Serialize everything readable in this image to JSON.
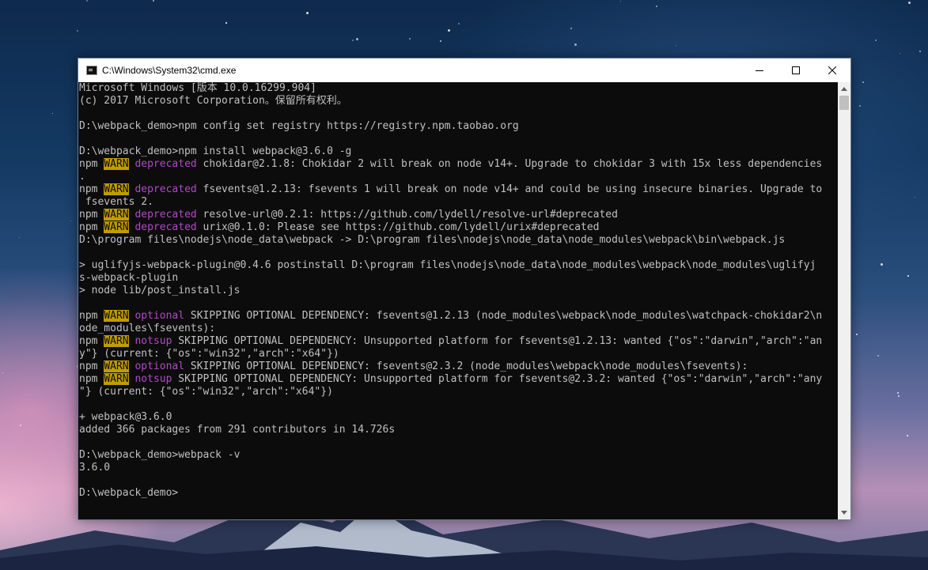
{
  "window": {
    "title": "C:\\Windows\\System32\\cmd.exe",
    "icons": {
      "app": "console-app-icon",
      "minimize": "minimize-icon",
      "maximize": "maximize-icon",
      "close": "close-icon"
    }
  },
  "colors": {
    "warn_bg": "#c19c00",
    "keyword": "#b148c6",
    "text": "#c0c0c0",
    "console_bg": "#0c0c0c"
  },
  "console": {
    "lines": [
      [
        {
          "t": "Microsoft Windows [版本 10.0.16299.904]"
        }
      ],
      [
        {
          "t": "(c) 2017 Microsoft Corporation。保留所有权利。"
        }
      ],
      [
        {
          "t": ""
        }
      ],
      [
        {
          "t": "D:\\webpack_demo>npm config set registry https://registry.npm.taobao.org"
        }
      ],
      [
        {
          "t": ""
        }
      ],
      [
        {
          "t": "D:\\webpack_demo>npm install webpack@3.6.0 -g"
        }
      ],
      [
        {
          "t": "npm "
        },
        {
          "t": "WARN",
          "c": "warn"
        },
        {
          "t": " "
        },
        {
          "t": "deprecated",
          "c": "kw"
        },
        {
          "t": " chokidar@2.1.8: Chokidar 2 will break on node v14+. Upgrade to chokidar 3 with 15x less dependencies"
        }
      ],
      [
        {
          "t": "."
        }
      ],
      [
        {
          "t": "npm "
        },
        {
          "t": "WARN",
          "c": "warn"
        },
        {
          "t": " "
        },
        {
          "t": "deprecated",
          "c": "kw"
        },
        {
          "t": " fsevents@1.2.13: fsevents 1 will break on node v14+ and could be using insecure binaries. Upgrade to"
        }
      ],
      [
        {
          "t": " fsevents 2."
        }
      ],
      [
        {
          "t": "npm "
        },
        {
          "t": "WARN",
          "c": "warn"
        },
        {
          "t": " "
        },
        {
          "t": "deprecated",
          "c": "kw"
        },
        {
          "t": " resolve-url@0.2.1: https://github.com/lydell/resolve-url#deprecated"
        }
      ],
      [
        {
          "t": "npm "
        },
        {
          "t": "WARN",
          "c": "warn"
        },
        {
          "t": " "
        },
        {
          "t": "deprecated",
          "c": "kw"
        },
        {
          "t": " urix@0.1.0: Please see https://github.com/lydell/urix#deprecated"
        }
      ],
      [
        {
          "t": "D:\\program files\\nodejs\\node_data\\webpack -> D:\\program files\\nodejs\\node_data\\node_modules\\webpack\\bin\\webpack.js"
        }
      ],
      [
        {
          "t": ""
        }
      ],
      [
        {
          "t": "> uglifyjs-webpack-plugin@0.4.6 postinstall D:\\program files\\nodejs\\node_data\\node_modules\\webpack\\node_modules\\uglifyj"
        }
      ],
      [
        {
          "t": "s-webpack-plugin"
        }
      ],
      [
        {
          "t": "> node lib/post_install.js"
        }
      ],
      [
        {
          "t": ""
        }
      ],
      [
        {
          "t": "npm "
        },
        {
          "t": "WARN",
          "c": "warn"
        },
        {
          "t": " "
        },
        {
          "t": "optional",
          "c": "kw"
        },
        {
          "t": " SKIPPING OPTIONAL DEPENDENCY: fsevents@1.2.13 (node_modules\\webpack\\node_modules\\watchpack-chokidar2\\n"
        }
      ],
      [
        {
          "t": "ode_modules\\fsevents):"
        }
      ],
      [
        {
          "t": "npm "
        },
        {
          "t": "WARN",
          "c": "warn"
        },
        {
          "t": " "
        },
        {
          "t": "notsup",
          "c": "kw"
        },
        {
          "t": " SKIPPING OPTIONAL DEPENDENCY: Unsupported platform for fsevents@1.2.13: wanted {\"os\":\"darwin\",\"arch\":\"an"
        }
      ],
      [
        {
          "t": "y\"} (current: {\"os\":\"win32\",\"arch\":\"x64\"})"
        }
      ],
      [
        {
          "t": "npm "
        },
        {
          "t": "WARN",
          "c": "warn"
        },
        {
          "t": " "
        },
        {
          "t": "optional",
          "c": "kw"
        },
        {
          "t": " SKIPPING OPTIONAL DEPENDENCY: fsevents@2.3.2 (node_modules\\webpack\\node_modules\\fsevents):"
        }
      ],
      [
        {
          "t": "npm "
        },
        {
          "t": "WARN",
          "c": "warn"
        },
        {
          "t": " "
        },
        {
          "t": "notsup",
          "c": "kw"
        },
        {
          "t": " SKIPPING OPTIONAL DEPENDENCY: Unsupported platform for fsevents@2.3.2: wanted {\"os\":\"darwin\",\"arch\":\"any"
        }
      ],
      [
        {
          "t": "\"} (current: {\"os\":\"win32\",\"arch\":\"x64\"})"
        }
      ],
      [
        {
          "t": ""
        }
      ],
      [
        {
          "t": "+ webpack@3.6.0"
        }
      ],
      [
        {
          "t": "added 366 packages from 291 contributors in 14.726s"
        }
      ],
      [
        {
          "t": ""
        }
      ],
      [
        {
          "t": "D:\\webpack_demo>webpack -v"
        }
      ],
      [
        {
          "t": "3.6.0"
        }
      ],
      [
        {
          "t": ""
        }
      ],
      [
        {
          "t": "D:\\webpack_demo>"
        }
      ]
    ]
  }
}
